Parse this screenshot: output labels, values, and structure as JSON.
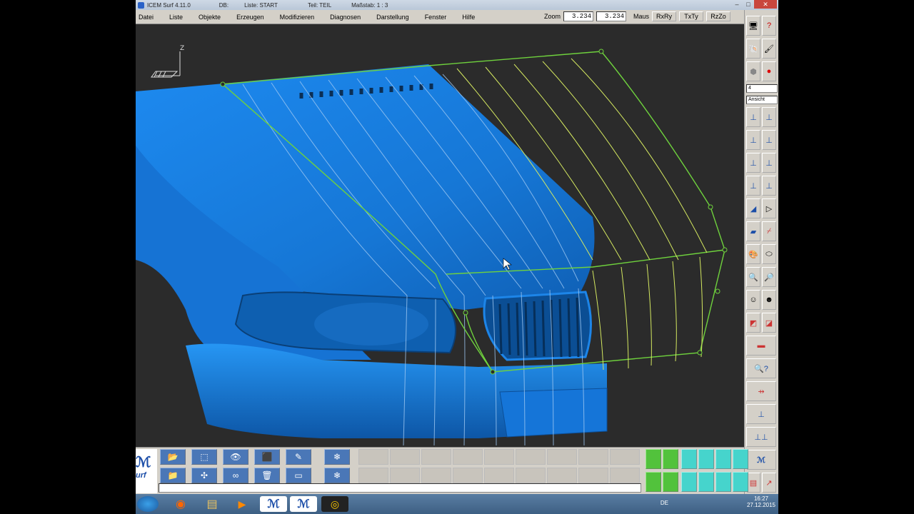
{
  "titlebar": {
    "app_title": "ICEM Surf 4.11.0",
    "db_label": "DB:",
    "liste_label": "Liste: START",
    "teil_label": "Teil: TEIL",
    "massstab_label": "Maßstab: 1 : 3"
  },
  "menu": [
    "Datei",
    "Liste",
    "Objekte",
    "Erzeugen",
    "Modifizieren",
    "Diagnosen",
    "Darstellung",
    "Fenster",
    "Hilfe"
  ],
  "toolbar": {
    "zoom_label": "Zoom",
    "zoom_value1": "3.234",
    "zoom_value2": "3.234",
    "maus_label": "Maus",
    "btn_rxry": "RxRy",
    "btn_txty": "TxTy",
    "btn_rzzo": "RzZo"
  },
  "rightpanel": {
    "combo_value": "4",
    "view_combo": "Ansicht"
  },
  "logo_text": "urf",
  "taskbar": {
    "lang": "DE",
    "time": "16:27",
    "date": "27.12.2015"
  },
  "colors": {
    "car_blue": "#1f86ea",
    "wire_green": "#6fd23d",
    "viewport_bg": "#2b2b2b"
  }
}
